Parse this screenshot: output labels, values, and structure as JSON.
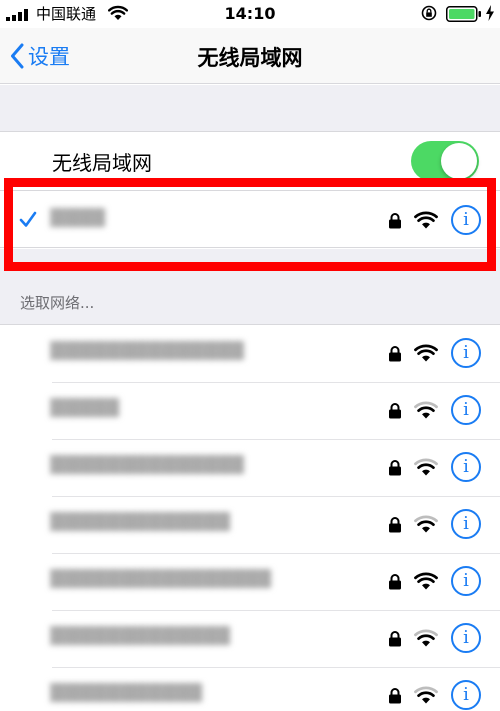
{
  "status_bar": {
    "carrier": "中国联通",
    "time": "14:10"
  },
  "nav": {
    "back_label": "设置",
    "title": "无线局域网"
  },
  "wifi_toggle": {
    "label": "无线局域网",
    "on": true
  },
  "connected_network": {
    "name": "▓▓▓▓",
    "secured": true,
    "signal_bars": 3,
    "info_label": "i"
  },
  "section": {
    "header": "选取网络..."
  },
  "networks": [
    {
      "name": "▓▓▓▓▓▓▓▓▓▓▓▓▓▓",
      "secured": true,
      "signal_bars": 3,
      "info_label": "i"
    },
    {
      "name": "▓▓▓▓▓",
      "secured": true,
      "signal_bars": 2,
      "info_label": "i"
    },
    {
      "name": "▓▓▓▓▓▓▓▓▓▓▓▓▓▓",
      "secured": true,
      "signal_bars": 2,
      "info_label": "i"
    },
    {
      "name": "▓▓▓▓▓▓▓▓▓▓▓▓▓",
      "secured": true,
      "signal_bars": 2,
      "info_label": "i"
    },
    {
      "name": "▓▓▓▓▓▓▓▓▓▓▓▓▓▓▓▓",
      "secured": true,
      "signal_bars": 3,
      "info_label": "i"
    },
    {
      "name": "▓▓▓▓▓▓▓▓▓▓▓▓▓",
      "secured": true,
      "signal_bars": 2,
      "info_label": "i"
    },
    {
      "name": "▓▓▓▓▓▓▓▓▓▓▓",
      "secured": true,
      "signal_bars": 2,
      "info_label": "i"
    }
  ],
  "colors": {
    "accent": "#1a7cf3",
    "toggle_on": "#4cd964",
    "highlight": "#ff0000",
    "grouped_bg": "#efeff4"
  }
}
